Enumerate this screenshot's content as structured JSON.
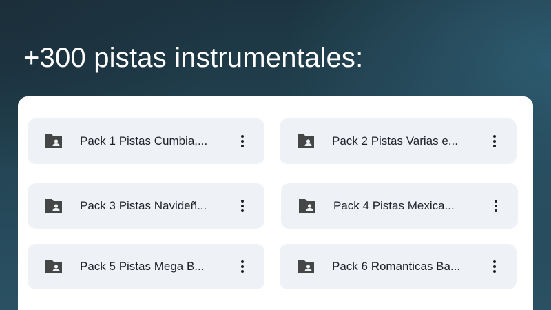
{
  "headline": "+300 pistas instrumentales:",
  "folders": [
    {
      "label": "Pack 1 Pistas Cumbia,...",
      "icon": "shared-folder-icon",
      "menu_icon": "more-vert-icon"
    },
    {
      "label": "Pack 2 Pistas Varias e...",
      "icon": "shared-folder-icon",
      "menu_icon": "more-vert-icon"
    },
    {
      "label": "Pack 3 Pistas Navideñ...",
      "icon": "shared-folder-icon",
      "menu_icon": "more-vert-icon"
    },
    {
      "label": "Pack 4 Pistas Mexica...",
      "icon": "shared-folder-icon",
      "menu_icon": "more-vert-icon"
    },
    {
      "label": "Pack 5 Pistas Mega B...",
      "icon": "shared-folder-icon",
      "menu_icon": "more-vert-icon"
    },
    {
      "label": "Pack 6 Romanticas Ba...",
      "icon": "shared-folder-icon",
      "menu_icon": "more-vert-icon"
    }
  ],
  "colors": {
    "card_background": "#eef1f6",
    "icon": "#444746",
    "text": "#1f2328",
    "panel": "#ffffff"
  }
}
